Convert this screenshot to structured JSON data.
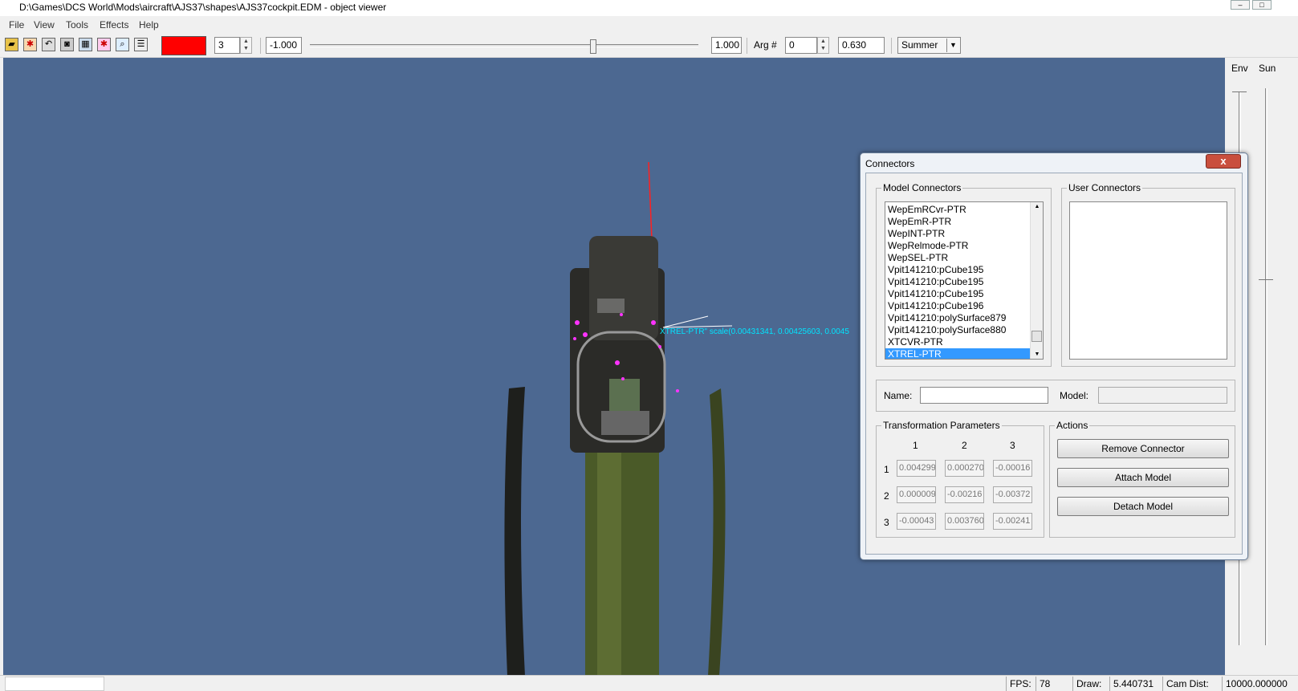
{
  "window": {
    "title": "D:\\Games\\DCS World\\Mods\\aircraft\\AJS37\\shapes\\AJS37cockpit.EDM - object viewer"
  },
  "menu": [
    "File",
    "View",
    "Tools",
    "Effects",
    "Help"
  ],
  "toolbar": {
    "color_swatch": "#ff0000",
    "lod_value": "3",
    "min_value": "-1.000",
    "max_value": "1.000",
    "slider_position": 0.73,
    "arg_label": "Arg #",
    "arg_value": "0",
    "arg_float": "0.630",
    "season_value": "Summer"
  },
  "viewport": {
    "background": "#4c6891",
    "annotation": "XTREL-PTR\" scale(0.00431341, 0.00425603, 0.0045"
  },
  "sidepanel": {
    "env_label": "Env",
    "sun_label": "Sun"
  },
  "dialog": {
    "title": "Connectors",
    "close_glyph": "x",
    "model_connectors_label": "Model Connectors",
    "user_connectors_label": "User Connectors",
    "model_connectors": [
      "WepEmRCvr-PTR",
      "WepEmR-PTR",
      "WepINT-PTR",
      "WepRelmode-PTR",
      "WepSEL-PTR",
      "Vpit141210:pCube195",
      "Vpit141210:pCube195",
      "Vpit141210:pCube195",
      "Vpit141210:pCube196",
      "Vpit141210:polySurface879",
      "Vpit141210:polySurface880",
      "XTCVR-PTR",
      "XTREL-PTR"
    ],
    "selected_index": 12,
    "name_label": "Name:",
    "name_value": "",
    "model_label": "Model:",
    "model_value": "",
    "transform_label": "Transformation Parameters",
    "col_headers": [
      "1",
      "2",
      "3"
    ],
    "row_headers": [
      "1",
      "2",
      "3"
    ],
    "matrix": [
      [
        "0.004299",
        "0.000270",
        "-0.00016"
      ],
      [
        "0.000009",
        "-0.00216",
        "-0.00372"
      ],
      [
        "-0.00043",
        "0.003760",
        "-0.00241"
      ]
    ],
    "actions_label": "Actions",
    "remove_button": "Remove Connector",
    "attach_button": "Attach Model",
    "detach_button": "Detach Model"
  },
  "status": {
    "fps_label": "FPS:",
    "fps_value": "78",
    "draw_label": "Draw:",
    "draw_value": "5.440731",
    "camdist_label": "Cam Dist:",
    "camdist_value": "10000.000000"
  }
}
